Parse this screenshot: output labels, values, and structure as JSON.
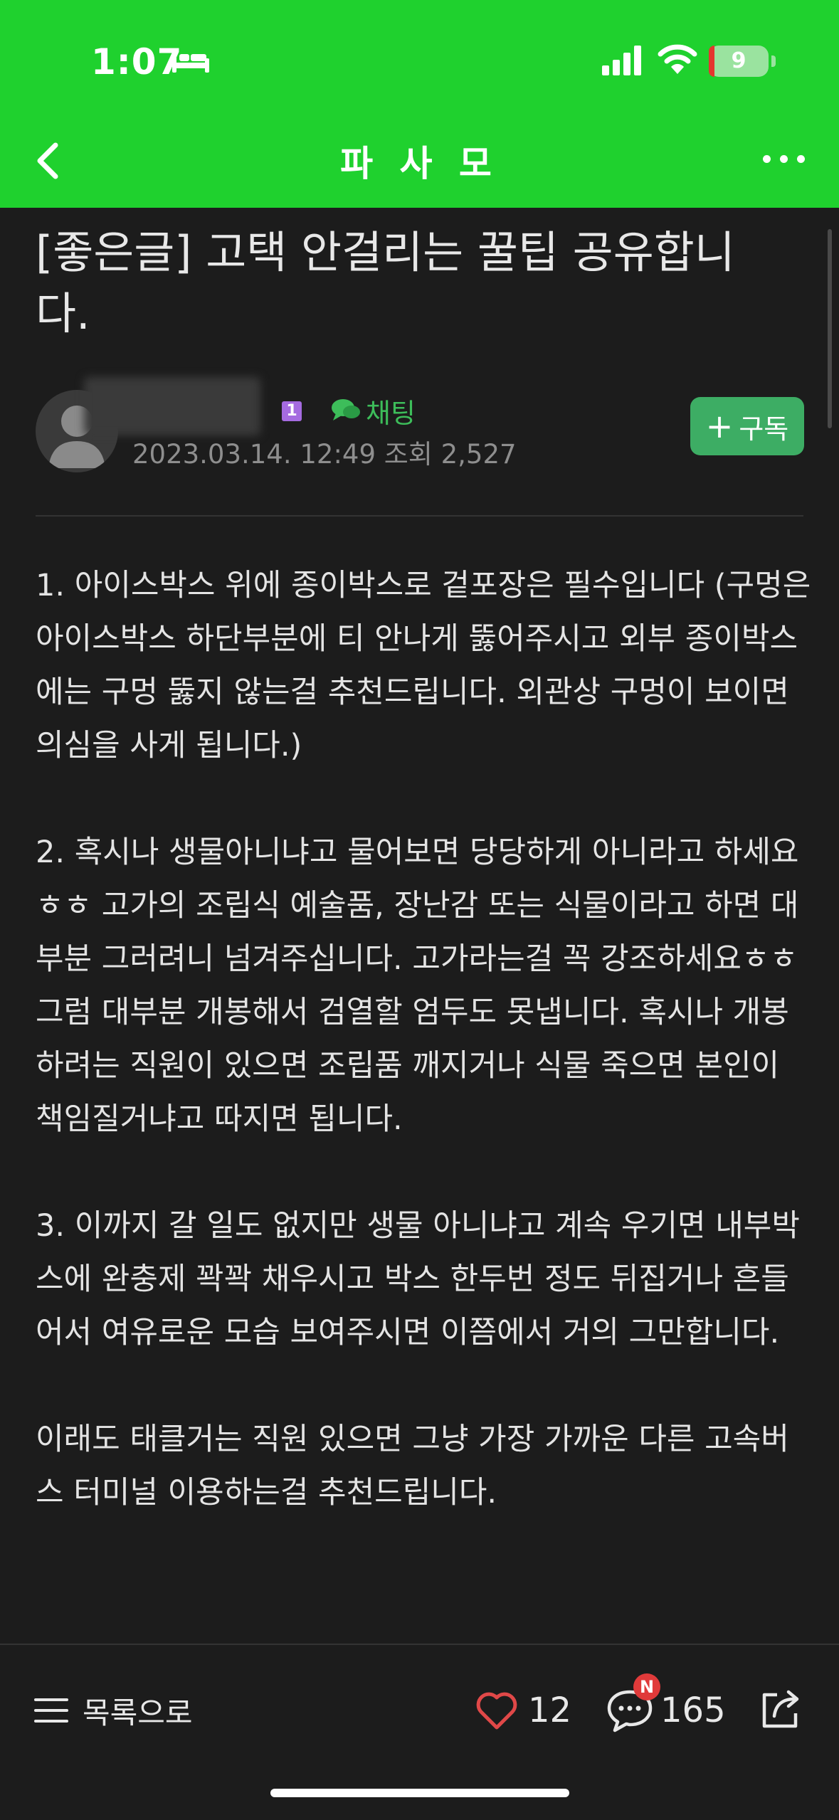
{
  "status_bar": {
    "time": "1:07",
    "battery": "9"
  },
  "header": {
    "title": "파 사 모"
  },
  "post": {
    "title": "[좋은글] 고택 안걸리는 꿀팁 공유합니다.",
    "level_badge": "1",
    "chat_label": "채팅",
    "meta": "2023.03.14. 12:49  조회 2,527",
    "subscribe_label": "구독",
    "paragraphs": [
      "1. 아이스박스 위에 종이박스로 겉포장은 필수입니다 (구멍은 아이스박스 하단부분에 티 안나게 뚫어주시고 외부 종이박스에는 구멍 뚫지 않는걸 추천드립니다. 외관상 구멍이 보이면 의심을 사게 됩니다.)",
      "2. 혹시나 생물아니냐고 물어보면 당당하게 아니라고 하세요ㅎㅎ 고가의 조립식 예술품, 장난감 또는 식물이라고 하면 대부분 그러려니 넘겨주십니다. 고가라는걸 꼭 강조하세요ㅎㅎ 그럼 대부분 개봉해서 검열할 엄두도 못냅니다. 혹시나 개봉하려는 직원이 있으면 조립품 깨지거나 식물 죽으면 본인이 책임질거냐고 따지면 됩니다.",
      "3. 이까지 갈 일도 없지만 생물 아니냐고 계속 우기면 내부박스에 완충제 꽉꽉 채우시고 박스 한두번 정도 뒤집거나 흔들어서 여유로운 모습 보여주시면 이쯤에서 거의 그만합니다.",
      "이래도 태클거는 직원 있으면 그냥 가장 가까운 다른 고속버스 터미널 이용하는걸 추천드립니다."
    ]
  },
  "bottom_bar": {
    "list_label": "목록으로",
    "likes": "12",
    "comments": "165",
    "comment_badge": "N"
  },
  "colors": {
    "brand_green": "#1fd12e",
    "accent_green": "#3dad64",
    "background": "#1c1c1c"
  },
  "icons": [
    "bed-icon",
    "cellular-signal-icon",
    "wifi-icon",
    "battery-icon",
    "back-chevron-icon",
    "more-dots-icon",
    "avatar-placeholder-icon",
    "chat-bubbles-icon",
    "plus-icon",
    "hamburger-icon",
    "heart-icon",
    "comment-icon",
    "share-icon"
  ]
}
